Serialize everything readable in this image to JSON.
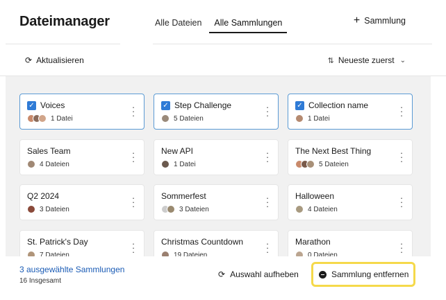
{
  "header": {
    "title": "Dateimanager",
    "tabs": [
      {
        "label": "Alle Dateien",
        "active": false
      },
      {
        "label": "Alle Sammlungen",
        "active": true
      }
    ],
    "new_collection_label": "Sammlung",
    "new_collection_icon": "plus-icon"
  },
  "toolbar": {
    "refresh_label": "Aktualisieren",
    "refresh_icon": "refresh-icon",
    "sort_label": "Neueste zuerst",
    "sort_icon": "sort-icon"
  },
  "collections": [
    {
      "name": "Voices",
      "count": "1 Datei",
      "selected": true,
      "avatars": [
        "#c98a6b",
        "#8a6b5a",
        "#d1a58a"
      ]
    },
    {
      "name": "Step Challenge",
      "count": "5 Dateien",
      "selected": true,
      "avatars": [
        "#9a8a7a"
      ]
    },
    {
      "name": "Collection name",
      "count": "1 Datei",
      "selected": true,
      "avatars": [
        "#b58a70"
      ]
    },
    {
      "name": "Sales Team",
      "count": "4 Dateien",
      "selected": false,
      "avatars": [
        "#a08874"
      ]
    },
    {
      "name": "New API",
      "count": "1 Datei",
      "selected": false,
      "avatars": [
        "#6b5a4e"
      ]
    },
    {
      "name": "The Next Best Thing",
      "count": "5 Dateien",
      "selected": false,
      "avatars": [
        "#c98a6b",
        "#7a5a4a",
        "#a89078"
      ]
    },
    {
      "name": "Q2 2024",
      "count": "3 Dateien",
      "selected": false,
      "avatars": [
        "#8a4a3a"
      ]
    },
    {
      "name": "Sommerfest",
      "count": "3 Dateien",
      "selected": false,
      "avatars": [
        "#cccccc",
        "#9a8a70"
      ]
    },
    {
      "name": "Halloween",
      "count": "4 Dateien",
      "selected": false,
      "avatars": [
        "#a89a80"
      ]
    },
    {
      "name": "St. Patrick's Day",
      "count": "7 Dateien",
      "selected": false,
      "avatars": [
        "#b0957a"
      ]
    },
    {
      "name": "Christmas Countdown",
      "count": "19 Dateien",
      "selected": false,
      "avatars": [
        "#9a8070"
      ]
    },
    {
      "name": "Marathon",
      "count": "0 Dateien",
      "selected": false,
      "avatars": [
        "#bba590"
      ]
    }
  ],
  "footer": {
    "selected_count": "3 ausgewählte Sammlungen",
    "total": "16 Insgesamt",
    "clear_selection_label": "Auswahl aufheben",
    "remove_label": "Sammlung entfernen"
  },
  "colors": {
    "accent": "#2f7bd6",
    "selected_link": "#1a5bb5",
    "highlight": "#f5d94a"
  }
}
